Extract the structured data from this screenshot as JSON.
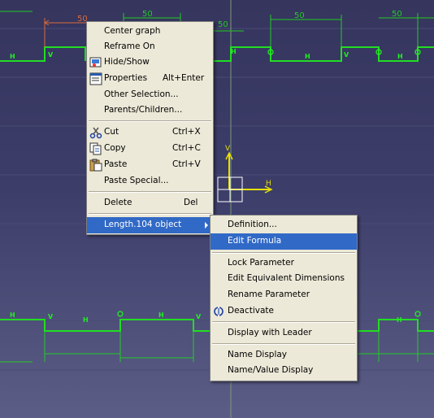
{
  "canvas": {
    "dimension_top_labels": [
      "50",
      "50",
      "50",
      "50",
      "50"
    ],
    "constraint_labels_top": [
      "H",
      "V",
      "H",
      "H",
      "V",
      "H"
    ],
    "constraint_labels_bottom": [
      "H",
      "V",
      "H",
      "H",
      "H",
      "V",
      "H"
    ],
    "axis_v": "V",
    "axis_h": "H"
  },
  "context_menu": {
    "items": [
      {
        "label": "Center graph",
        "shortcut": "",
        "icon": ""
      },
      {
        "label": "Reframe On",
        "shortcut": "",
        "icon": ""
      },
      {
        "label": "Hide/Show",
        "shortcut": "",
        "icon": "hide-show-icon"
      },
      {
        "label": "Properties",
        "shortcut": "Alt+Enter",
        "icon": "properties-icon"
      },
      {
        "label": "Other Selection...",
        "shortcut": "",
        "icon": ""
      },
      {
        "label": "Parents/Children...",
        "shortcut": "",
        "icon": ""
      },
      {
        "label": "Cut",
        "shortcut": "Ctrl+X",
        "icon": "scissors-icon"
      },
      {
        "label": "Copy",
        "shortcut": "Ctrl+C",
        "icon": "copy-icon"
      },
      {
        "label": "Paste",
        "shortcut": "Ctrl+V",
        "icon": "paste-icon"
      },
      {
        "label": "Paste Special...",
        "shortcut": "",
        "icon": ""
      },
      {
        "label": "Delete",
        "shortcut": "Del",
        "icon": ""
      },
      {
        "label": "Length.104 object",
        "shortcut": "",
        "icon": ""
      }
    ]
  },
  "submenu": {
    "items": [
      {
        "label": "Definition...",
        "icon": ""
      },
      {
        "label": "Edit Formula",
        "icon": ""
      },
      {
        "label": "Lock Parameter",
        "icon": ""
      },
      {
        "label": "Edit Equivalent Dimensions",
        "icon": ""
      },
      {
        "label": "Rename Parameter",
        "icon": ""
      },
      {
        "label": "Deactivate",
        "icon": "deactivate-icon"
      },
      {
        "label": "Display with Leader",
        "icon": ""
      },
      {
        "label": "Name Display",
        "icon": ""
      },
      {
        "label": "Name/Value Display",
        "icon": ""
      }
    ]
  },
  "colors": {
    "profile": "#22dd22",
    "dimension": "#22cc22",
    "selected_dimension": "#d86b3a",
    "axis": "#e8e000",
    "menu_highlight": "#3169c6",
    "menu_bg": "#ece9d8"
  }
}
